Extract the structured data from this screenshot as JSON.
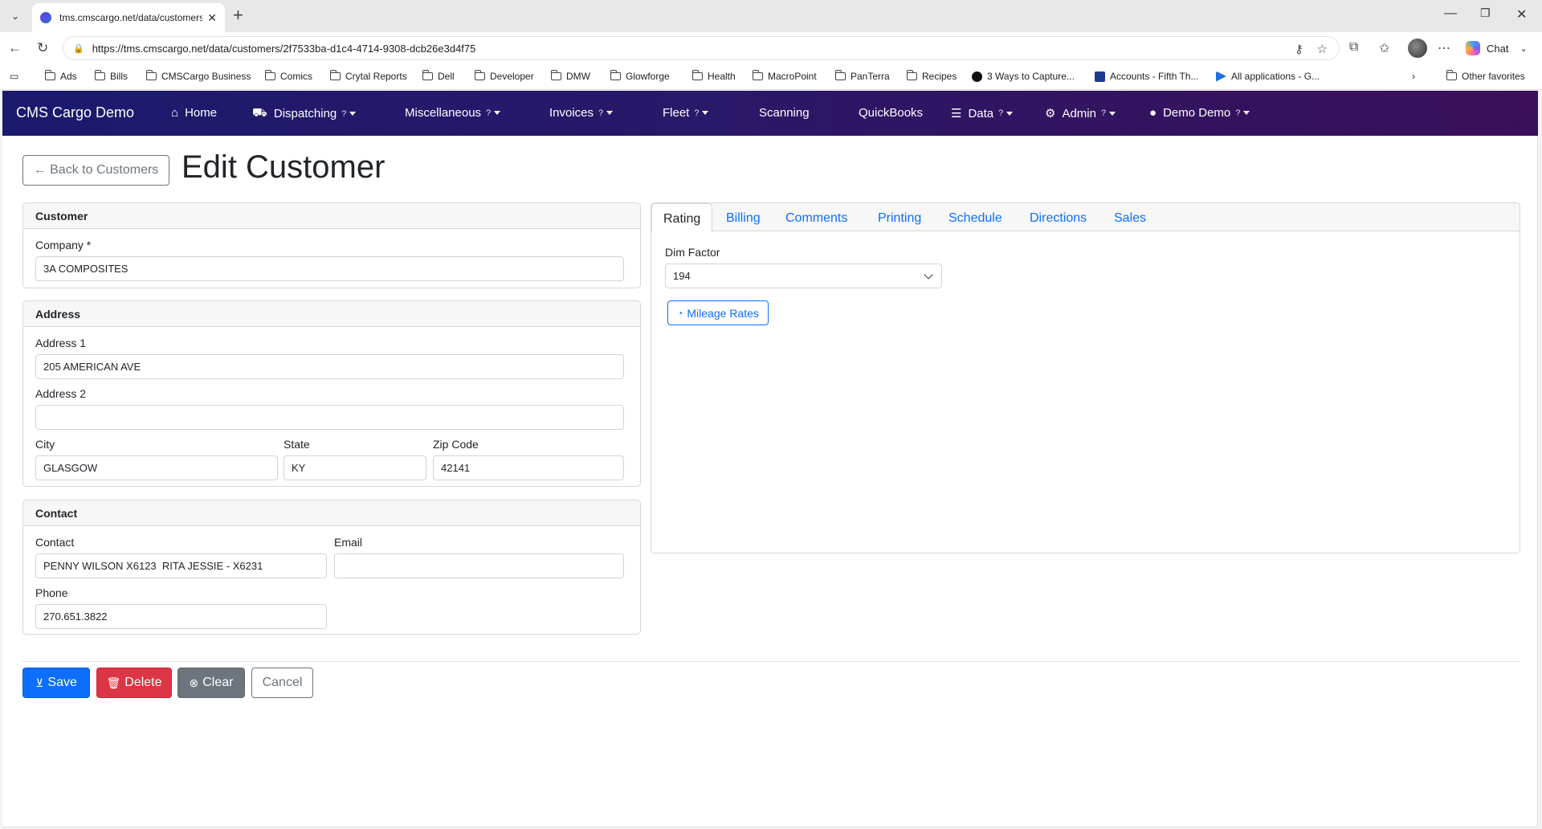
{
  "browser": {
    "tab_title": "tms.cmscargo.net/data/customers/",
    "url": "https://tms.cmscargo.net/data/customers/2f7533ba-d1c4-4714-9308-dcb26e3d4f75",
    "chat_label": "Chat",
    "bookmarks": [
      {
        "label": "Ads"
      },
      {
        "label": "Bills"
      },
      {
        "label": "CMSCargo Business"
      },
      {
        "label": "Comics"
      },
      {
        "label": "Crytal Reports"
      },
      {
        "label": "Dell"
      },
      {
        "label": "Developer"
      },
      {
        "label": "DMW"
      },
      {
        "label": "Glowforge"
      },
      {
        "label": "Health"
      },
      {
        "label": "MacroPoint"
      },
      {
        "label": "PanTerra"
      },
      {
        "label": "Recipes"
      },
      {
        "label": "3 Ways to Capture..."
      },
      {
        "label": "Accounts - Fifth Th..."
      },
      {
        "label": "All applications - G..."
      }
    ],
    "other_favorites": "Other favorites"
  },
  "navbar": {
    "brand": "CMS Cargo Demo",
    "items": [
      {
        "label": "Home"
      },
      {
        "label": "Dispatching",
        "help": "?"
      },
      {
        "label": "Miscellaneous",
        "help": "?"
      },
      {
        "label": "Invoices",
        "help": "?"
      },
      {
        "label": "Fleet",
        "help": "?"
      },
      {
        "label": "Scanning"
      },
      {
        "label": "QuickBooks"
      },
      {
        "label": "Data",
        "help": "?"
      },
      {
        "label": "Admin",
        "help": "?"
      },
      {
        "label": "Demo Demo",
        "help": "?"
      }
    ]
  },
  "header": {
    "back_label": "← Back to Customers",
    "title": "Edit Customer"
  },
  "customer": {
    "section": "Customer",
    "company_label": "Company *",
    "company_value": "3A COMPOSITES"
  },
  "address": {
    "section": "Address",
    "address1_label": "Address 1",
    "address1_value": "205 AMERICAN AVE",
    "address2_label": "Address 2",
    "address2_value": "",
    "city_label": "City",
    "city_value": "GLASGOW",
    "state_label": "State",
    "state_value": "KY",
    "zip_label": "Zip Code",
    "zip_value": "42141"
  },
  "contact": {
    "section": "Contact",
    "contact_label": "Contact",
    "contact_value": "PENNY WILSON X6123  RITA JESSIE - X6231",
    "email_label": "Email",
    "email_value": "",
    "phone_label": "Phone",
    "phone_value": "270.651.3822"
  },
  "tabs": {
    "items": [
      {
        "label": "Rating",
        "active": true
      },
      {
        "label": "Billing"
      },
      {
        "label": "Comments"
      },
      {
        "label": "Printing"
      },
      {
        "label": "Schedule"
      },
      {
        "label": "Directions"
      },
      {
        "label": "Sales"
      }
    ],
    "rating": {
      "dim_factor_label": "Dim Factor",
      "dim_factor_value": "194",
      "mileage_rates_label": "Mileage Rates"
    }
  },
  "actions": {
    "save": "Save",
    "delete": "Delete",
    "clear": "Clear",
    "cancel": "Cancel"
  },
  "colors": {
    "primary": "#0d6efd",
    "danger": "#dc3545",
    "secondary": "#6c757d",
    "navbar_start": "#1b1a6e",
    "navbar_end": "#3b0f59"
  }
}
